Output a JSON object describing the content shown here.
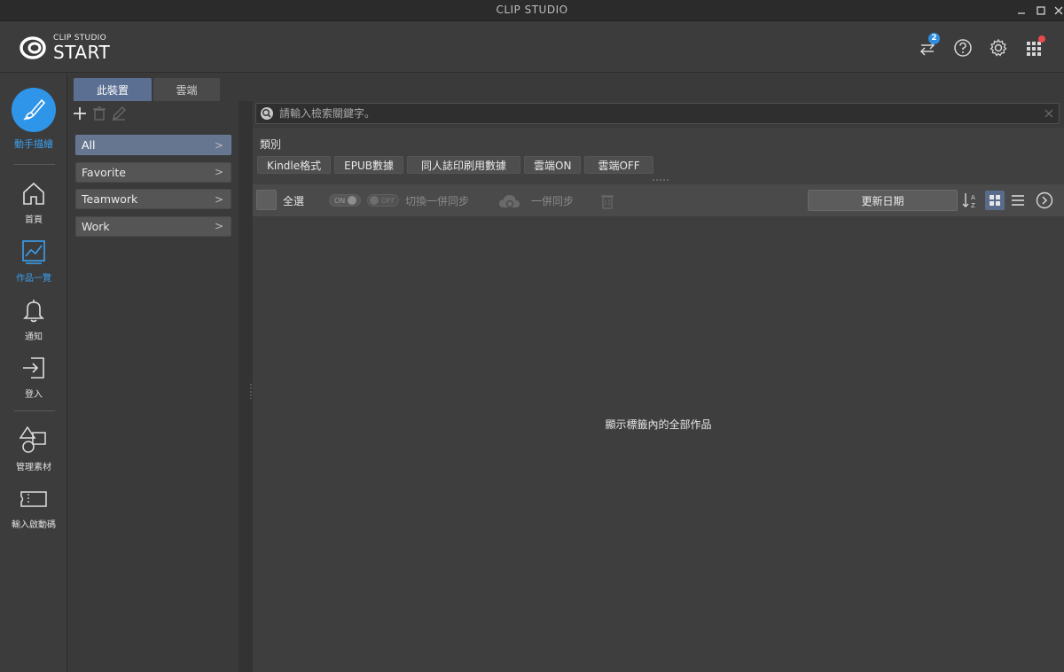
{
  "window": {
    "title": "CLIP STUDIO"
  },
  "logo": {
    "small": "CLIP STUDIO",
    "big": "START"
  },
  "header": {
    "sync_badge": "2"
  },
  "leftnav": {
    "feature_label": "動手描繪",
    "items": [
      {
        "label": "首頁"
      },
      {
        "label": "作品一覽"
      },
      {
        "label": "通知"
      },
      {
        "label": "登入"
      },
      {
        "label": "管理素材"
      },
      {
        "label": "輸入啟動碼"
      }
    ]
  },
  "tabs": [
    {
      "label": "此裝置"
    },
    {
      "label": "雲端"
    }
  ],
  "categories": [
    {
      "label": "All"
    },
    {
      "label": "Favorite"
    },
    {
      "label": "Teamwork"
    },
    {
      "label": "Work"
    }
  ],
  "search": {
    "placeholder": "請輸入檢索關鍵字。"
  },
  "filters": {
    "caption": "類別",
    "chips": [
      {
        "label": "Kindle格式"
      },
      {
        "label": "EPUB數據"
      },
      {
        "label": "同人誌印刷用數據"
      },
      {
        "label": "雲端ON"
      },
      {
        "label": "雲端OFF"
      }
    ]
  },
  "toolbar": {
    "select_all": "全選",
    "toggle_on": "ON",
    "toggle_off": "OFF",
    "switch_sync": "切換一併同步",
    "sync_all": "一併同步",
    "sort_label": "更新日期"
  },
  "content": {
    "empty_message": "顯示標籤內的全部作品"
  },
  "colors": {
    "accent": "#2f95e8",
    "active_tab": "#5b6f92",
    "badge_red": "#e84a4a"
  }
}
